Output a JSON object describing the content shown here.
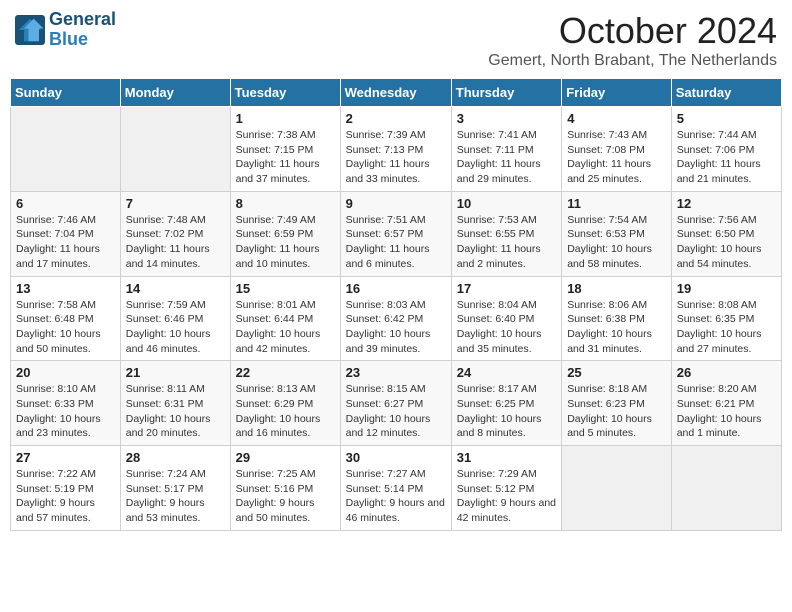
{
  "logo": {
    "line1": "General",
    "line2": "Blue"
  },
  "title": "October 2024",
  "location": "Gemert, North Brabant, The Netherlands",
  "weekdays": [
    "Sunday",
    "Monday",
    "Tuesday",
    "Wednesday",
    "Thursday",
    "Friday",
    "Saturday"
  ],
  "weeks": [
    [
      {
        "day": "",
        "detail": ""
      },
      {
        "day": "",
        "detail": ""
      },
      {
        "day": "1",
        "detail": "Sunrise: 7:38 AM\nSunset: 7:15 PM\nDaylight: 11 hours and 37 minutes."
      },
      {
        "day": "2",
        "detail": "Sunrise: 7:39 AM\nSunset: 7:13 PM\nDaylight: 11 hours and 33 minutes."
      },
      {
        "day": "3",
        "detail": "Sunrise: 7:41 AM\nSunset: 7:11 PM\nDaylight: 11 hours and 29 minutes."
      },
      {
        "day": "4",
        "detail": "Sunrise: 7:43 AM\nSunset: 7:08 PM\nDaylight: 11 hours and 25 minutes."
      },
      {
        "day": "5",
        "detail": "Sunrise: 7:44 AM\nSunset: 7:06 PM\nDaylight: 11 hours and 21 minutes."
      }
    ],
    [
      {
        "day": "6",
        "detail": "Sunrise: 7:46 AM\nSunset: 7:04 PM\nDaylight: 11 hours and 17 minutes."
      },
      {
        "day": "7",
        "detail": "Sunrise: 7:48 AM\nSunset: 7:02 PM\nDaylight: 11 hours and 14 minutes."
      },
      {
        "day": "8",
        "detail": "Sunrise: 7:49 AM\nSunset: 6:59 PM\nDaylight: 11 hours and 10 minutes."
      },
      {
        "day": "9",
        "detail": "Sunrise: 7:51 AM\nSunset: 6:57 PM\nDaylight: 11 hours and 6 minutes."
      },
      {
        "day": "10",
        "detail": "Sunrise: 7:53 AM\nSunset: 6:55 PM\nDaylight: 11 hours and 2 minutes."
      },
      {
        "day": "11",
        "detail": "Sunrise: 7:54 AM\nSunset: 6:53 PM\nDaylight: 10 hours and 58 minutes."
      },
      {
        "day": "12",
        "detail": "Sunrise: 7:56 AM\nSunset: 6:50 PM\nDaylight: 10 hours and 54 minutes."
      }
    ],
    [
      {
        "day": "13",
        "detail": "Sunrise: 7:58 AM\nSunset: 6:48 PM\nDaylight: 10 hours and 50 minutes."
      },
      {
        "day": "14",
        "detail": "Sunrise: 7:59 AM\nSunset: 6:46 PM\nDaylight: 10 hours and 46 minutes."
      },
      {
        "day": "15",
        "detail": "Sunrise: 8:01 AM\nSunset: 6:44 PM\nDaylight: 10 hours and 42 minutes."
      },
      {
        "day": "16",
        "detail": "Sunrise: 8:03 AM\nSunset: 6:42 PM\nDaylight: 10 hours and 39 minutes."
      },
      {
        "day": "17",
        "detail": "Sunrise: 8:04 AM\nSunset: 6:40 PM\nDaylight: 10 hours and 35 minutes."
      },
      {
        "day": "18",
        "detail": "Sunrise: 8:06 AM\nSunset: 6:38 PM\nDaylight: 10 hours and 31 minutes."
      },
      {
        "day": "19",
        "detail": "Sunrise: 8:08 AM\nSunset: 6:35 PM\nDaylight: 10 hours and 27 minutes."
      }
    ],
    [
      {
        "day": "20",
        "detail": "Sunrise: 8:10 AM\nSunset: 6:33 PM\nDaylight: 10 hours and 23 minutes."
      },
      {
        "day": "21",
        "detail": "Sunrise: 8:11 AM\nSunset: 6:31 PM\nDaylight: 10 hours and 20 minutes."
      },
      {
        "day": "22",
        "detail": "Sunrise: 8:13 AM\nSunset: 6:29 PM\nDaylight: 10 hours and 16 minutes."
      },
      {
        "day": "23",
        "detail": "Sunrise: 8:15 AM\nSunset: 6:27 PM\nDaylight: 10 hours and 12 minutes."
      },
      {
        "day": "24",
        "detail": "Sunrise: 8:17 AM\nSunset: 6:25 PM\nDaylight: 10 hours and 8 minutes."
      },
      {
        "day": "25",
        "detail": "Sunrise: 8:18 AM\nSunset: 6:23 PM\nDaylight: 10 hours and 5 minutes."
      },
      {
        "day": "26",
        "detail": "Sunrise: 8:20 AM\nSunset: 6:21 PM\nDaylight: 10 hours and 1 minute."
      }
    ],
    [
      {
        "day": "27",
        "detail": "Sunrise: 7:22 AM\nSunset: 5:19 PM\nDaylight: 9 hours and 57 minutes."
      },
      {
        "day": "28",
        "detail": "Sunrise: 7:24 AM\nSunset: 5:17 PM\nDaylight: 9 hours and 53 minutes."
      },
      {
        "day": "29",
        "detail": "Sunrise: 7:25 AM\nSunset: 5:16 PM\nDaylight: 9 hours and 50 minutes."
      },
      {
        "day": "30",
        "detail": "Sunrise: 7:27 AM\nSunset: 5:14 PM\nDaylight: 9 hours and 46 minutes."
      },
      {
        "day": "31",
        "detail": "Sunrise: 7:29 AM\nSunset: 5:12 PM\nDaylight: 9 hours and 42 minutes."
      },
      {
        "day": "",
        "detail": ""
      },
      {
        "day": "",
        "detail": ""
      }
    ]
  ]
}
